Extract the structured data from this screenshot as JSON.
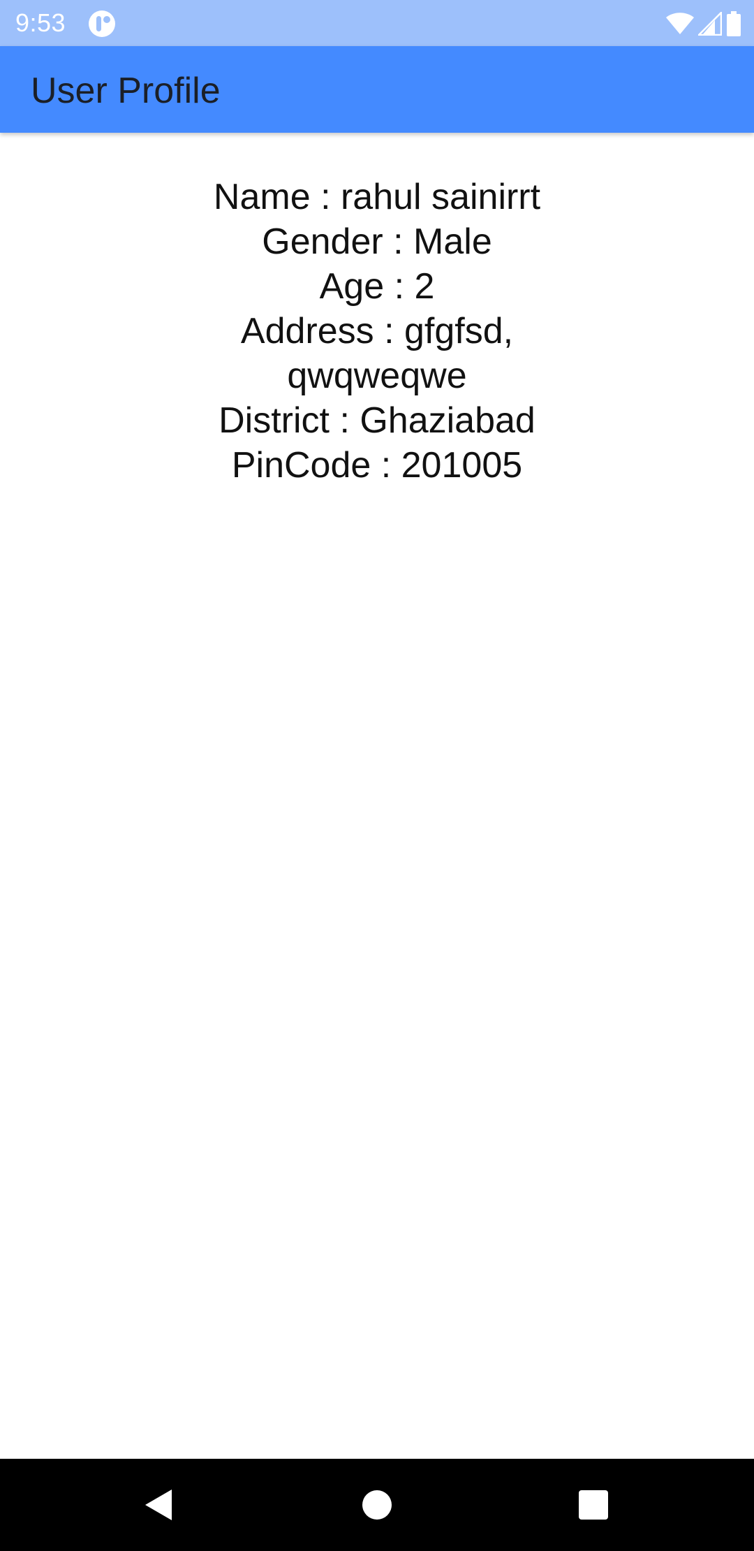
{
  "status_bar": {
    "time": "9:53",
    "icons": [
      "app-notification-icon",
      "wifi-icon",
      "cellular-signal-icon",
      "battery-icon"
    ]
  },
  "app_bar": {
    "title": "User Profile",
    "background_color": "#448aff"
  },
  "profile": {
    "lines": [
      "Name : rahul sainirrt",
      "Gender : Male",
      "Age : 2",
      "Address : gfgfsd,",
      "qwqweqwe",
      "District : Ghaziabad",
      "PinCode : 201005"
    ]
  },
  "nav_bar": {
    "buttons": [
      "back-icon",
      "home-icon",
      "recents-icon"
    ]
  }
}
